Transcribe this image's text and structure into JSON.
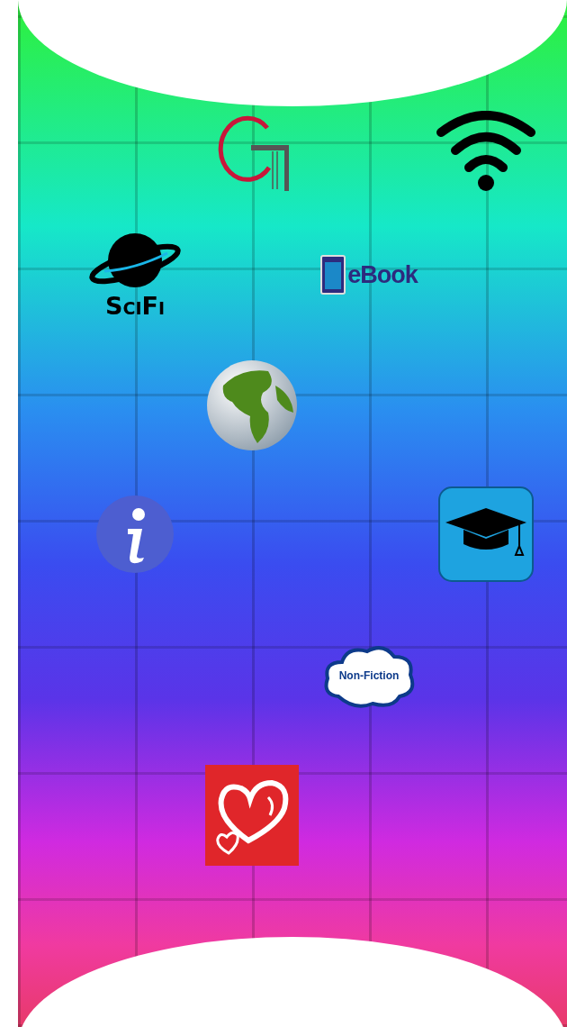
{
  "tiles": [
    {
      "kind": "logo"
    },
    {
      "kind": "wifi"
    },
    {
      "kind": "scifi",
      "label": "SciFi"
    },
    {
      "kind": "ebook",
      "label": "eBook"
    },
    {
      "kind": "globe"
    },
    {
      "kind": "info"
    },
    {
      "kind": "graduation"
    },
    {
      "kind": "nonfiction",
      "label": "Non-Fiction"
    },
    {
      "kind": "hearts"
    }
  ]
}
